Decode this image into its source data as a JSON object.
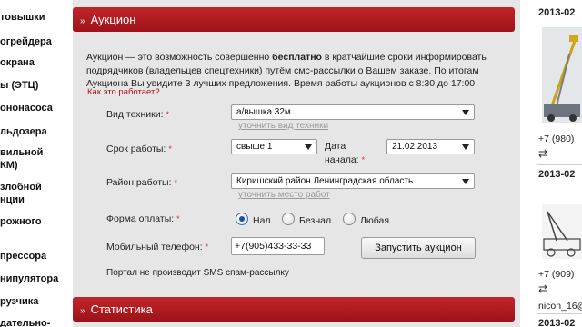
{
  "sidebar": {
    "items": [
      "товышки",
      "огрейдера",
      "окрана",
      "ы (ЭТЦ)",
      "ононасоса",
      "льдозера",
      "вильной",
      "КМ)",
      "злобной",
      "нции",
      "рожного",
      "прессора",
      "нипулятора",
      "рузчика",
      "дательно-"
    ]
  },
  "auction": {
    "title": "Аукцион",
    "intro_1": "Аукцион — это возможность совершенно ",
    "intro_bold_1": "бесплатно",
    "intro_2": " в кратчайшие сроки информировать подрядчиков (владельцев спецтехники) путём смс-рассылки о Вашем заказе. По итогам Аукциона Вы увидите ",
    "intro_3": "3 лучших предложения",
    "intro_4": ". Время работы аукционов с 8:30 до 17:00",
    "how_link": "Как это работает?",
    "equipment_label": "Вид техники:",
    "equipment_value": "а/вышка 32м",
    "equipment_hint": "уточнить вид техники",
    "term_label": "Срок работы:",
    "term_value": "свыше 1",
    "date_label_1": "Дата",
    "date_label_2": "начала:",
    "date_value": "21.02.2013",
    "region_label": "Район работы:",
    "region_value": "Киришский район Ленинградская область",
    "region_hint": "уточнить место работ",
    "payment_label": "Форма оплаты:",
    "payment_options": [
      "Нал.",
      "Безнал.",
      "Любая"
    ],
    "payment_selected": "Нал.",
    "phone_label": "Мобильный телефон:",
    "phone_value": "+7(905)433-33-33",
    "submit_label": "Запустить аукцион",
    "footnote": "Портал не производит SMS спам-рассылку",
    "required_mark": "*"
  },
  "stats": {
    "title": "Статистика"
  },
  "right": {
    "dates": [
      "2013-02",
      "2013-02",
      "2013-02"
    ],
    "phones": [
      "+7 (980)",
      "+7 (909)"
    ],
    "user": "nicon_16@"
  },
  "colors": {
    "accent": "#b01218",
    "panel": "#e6e6e6"
  }
}
